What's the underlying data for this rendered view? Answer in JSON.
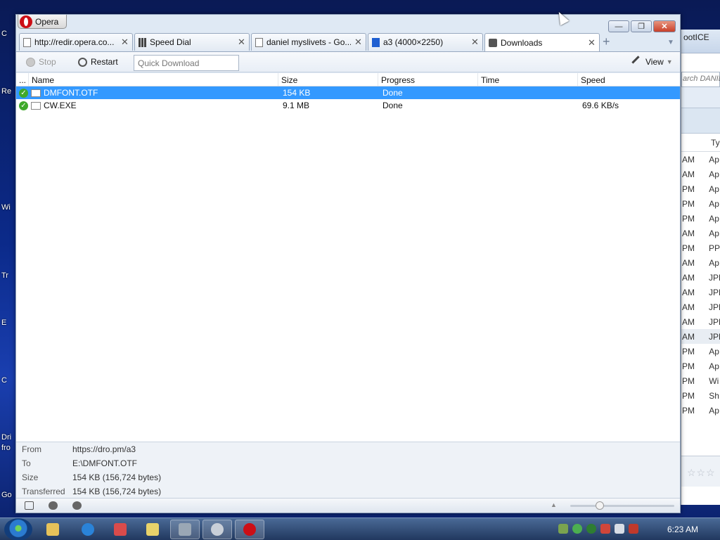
{
  "desktop": {
    "labels": [
      "C",
      "Re",
      "Wi",
      "Tr",
      "E",
      "C",
      "Dri",
      "fro",
      "Go"
    ]
  },
  "background_window": {
    "title": "ootICE",
    "search_placeholder": "arch DANIE",
    "column_header": "Ty",
    "rows": [
      {
        "time": "AM",
        "type": "Ap"
      },
      {
        "time": "AM",
        "type": "Ap"
      },
      {
        "time": "PM",
        "type": "Ap"
      },
      {
        "time": "PM",
        "type": "Ap"
      },
      {
        "time": "PM",
        "type": "Ap"
      },
      {
        "time": "AM",
        "type": "Ap"
      },
      {
        "time": "PM",
        "type": "PP"
      },
      {
        "time": "AM",
        "type": "Ap"
      },
      {
        "time": "AM",
        "type": "JPE"
      },
      {
        "time": "AM",
        "type": "JPE"
      },
      {
        "time": "AM",
        "type": "JPE"
      },
      {
        "time": "AM",
        "type": "JPE"
      },
      {
        "time": "AM",
        "type": "JPE"
      },
      {
        "time": "PM",
        "type": "Ap"
      },
      {
        "time": "PM",
        "type": "Ap"
      },
      {
        "time": "PM",
        "type": "Wi"
      },
      {
        "time": "PM",
        "type": "Sh"
      },
      {
        "time": "PM",
        "type": "Ap"
      }
    ],
    "rating": "☆☆☆"
  },
  "opera": {
    "menu_button": "Opera",
    "window_controls": {
      "minimize": "—",
      "maximize": "❐",
      "close": "✕"
    },
    "tabs": [
      {
        "title": "http://redir.opera.co...",
        "icon": "page-icon"
      },
      {
        "title": "Speed Dial",
        "icon": "grid-icon"
      },
      {
        "title": "daniel myslivets - Go...",
        "icon": "page-icon"
      },
      {
        "title": "a3 (4000×2250)",
        "icon": "image-icon"
      },
      {
        "title": "Downloads",
        "icon": "download-icon"
      }
    ],
    "new_tab": "+",
    "toolbar": {
      "stop": "Stop",
      "restart": "Restart",
      "quick_download_placeholder": "Quick Download",
      "view": "View"
    },
    "columns": [
      "...",
      "Name",
      "Size",
      "Progress",
      "Time",
      "Speed"
    ],
    "downloads": [
      {
        "name": "DMFONT.OTF",
        "size": "154 KB",
        "progress": "Done",
        "time": "",
        "speed": ""
      },
      {
        "name": "CW.EXE",
        "size": "9.1 MB",
        "progress": "Done",
        "time": "",
        "speed": "69.6 KB/s"
      }
    ],
    "details": {
      "from_label": "From",
      "from_value": "https://dro.pm/a3",
      "to_label": "To",
      "to_value": "E:\\DMFONT.OTF",
      "size_label": "Size",
      "size_value": "154 KB (156,724 bytes)",
      "transferred_label": "Transferred",
      "transferred_value": "154 KB (156,724 bytes)"
    }
  },
  "taskbar": {
    "clock": "6:23 AM"
  },
  "colors": {
    "selection": "#3399ff",
    "done_check": "#3fa92a",
    "opera_red": "#cc0f16"
  }
}
